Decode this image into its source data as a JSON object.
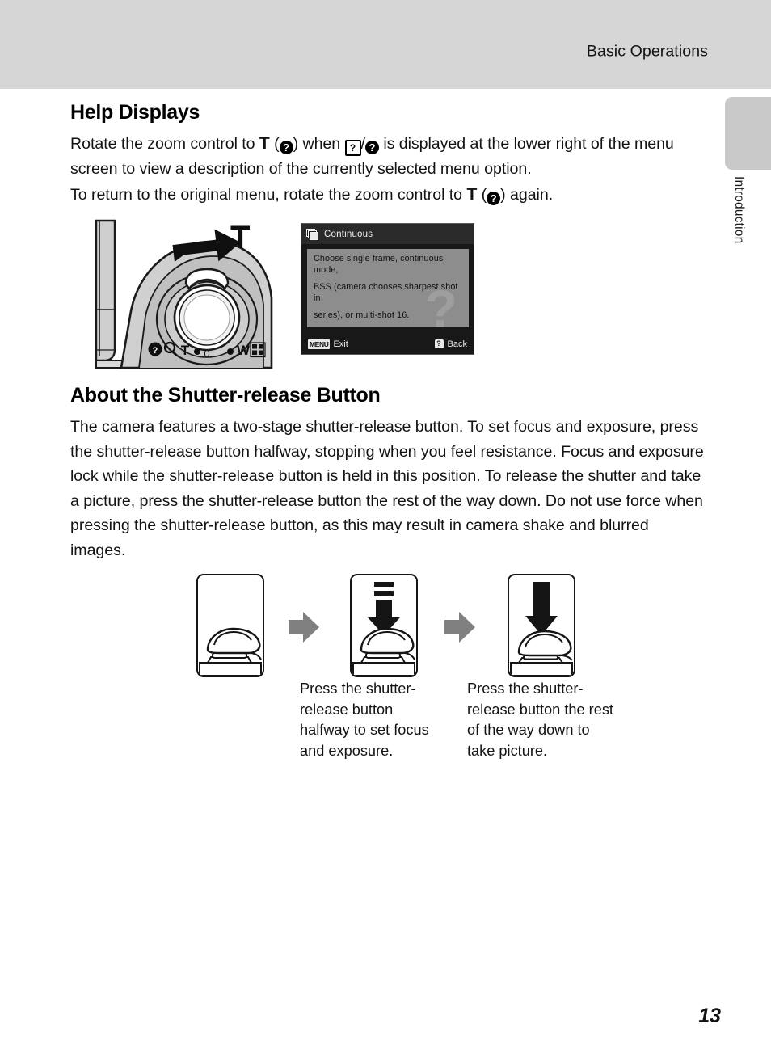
{
  "header": {
    "title": "Basic Operations"
  },
  "side_tab": {
    "label": "Introduction"
  },
  "sections": [
    {
      "heading": "Help Displays",
      "paragraphs": [
        {
          "id": "help-para-1",
          "parts": [
            "Rotate the zoom control to ",
            "T",
            " (",
            "?",
            ") when ",
            "?",
            "/",
            "?",
            " is displayed at the lower right of the menu screen to view a description of the currently selected menu option."
          ],
          "text_plain": "Rotate the zoom control to T (?) when ?/? is displayed at the lower right of the menu screen to view a description of the currently selected menu option."
        },
        {
          "id": "help-para-2",
          "text_plain": "To return to the original menu, rotate the zoom control to T (?) again."
        }
      ]
    },
    {
      "heading": "About the Shutter-release Button",
      "paragraphs": [
        {
          "id": "shutter-para-1",
          "text_plain": "The camera features a two-stage shutter-release button. To set focus and exposure, press the shutter-release button halfway, stopping when you feel resistance. Focus and exposure lock while the shutter-release button is held in this position. To release the shutter and take a picture, press the shutter-release button the rest of the way down. Do not use force when pressing the shutter-release button, as this may result in camera shake and blurred images."
        }
      ]
    }
  ],
  "help_text_fragments": {
    "t1": "Rotate the zoom control to ",
    "t2": "T",
    "t3": " (",
    "t4": ") when ",
    "t5": "/",
    "t6": " is displayed at the lower right of",
    "t7": "the menu screen to view a description of the currently selected menu option.",
    "q_mark": "?",
    "p2_a": "To return to the original menu, rotate the zoom control to ",
    "p2_b": "T",
    "p2_c": " (",
    "p2_d": ") again."
  },
  "camera_figure": {
    "zoom_label_t": "T",
    "control_marks": {
      "help": "?",
      "magnifier": "magnifier",
      "tele": "T",
      "wide": "W",
      "thumbnail": "thumbnail-grid"
    },
    "center_mark": "0"
  },
  "lcd_screen": {
    "title": "Continuous",
    "title_icon": "stacked-frames-icon",
    "help_lines": [
      "Choose single frame, continuous mode,",
      "BSS (camera chooses sharpest shot in",
      "series), or multi-shot 16."
    ],
    "watermark": "?",
    "footer": {
      "menu_badge": "MENU",
      "exit_label": "Exit",
      "back_badge": "?",
      "back_label": "Back"
    }
  },
  "shutter_sequence": {
    "panels": [
      {
        "id": "panel-rest",
        "state": "finger-resting",
        "arrow": "none"
      },
      {
        "id": "panel-halfway",
        "state": "press-halfway",
        "arrow": "down-arrow-with-dashes"
      },
      {
        "id": "panel-full",
        "state": "press-full",
        "arrow": "down-arrow-long"
      }
    ],
    "arrows": [
      {
        "id": "seq-arrow-1",
        "direction": "right"
      },
      {
        "id": "seq-arrow-2",
        "direction": "right"
      }
    ],
    "captions": [
      {
        "id": "caption-halfway",
        "lines": [
          "Press the shutter-",
          "release button",
          "halfway to set focus",
          "and exposure."
        ]
      },
      {
        "id": "caption-full",
        "lines": [
          "Press the shutter-",
          "release button the rest",
          "of the way down to",
          "take picture."
        ]
      }
    ]
  },
  "footer": {
    "page_number": "13"
  },
  "colors": {
    "header_band": "#d6d6d6",
    "side_tab": "#c9c9c9",
    "lcd_background": "#181818",
    "lcd_body": "#8d8d8d",
    "arrow_gray": "#808080",
    "text": "#131313"
  }
}
